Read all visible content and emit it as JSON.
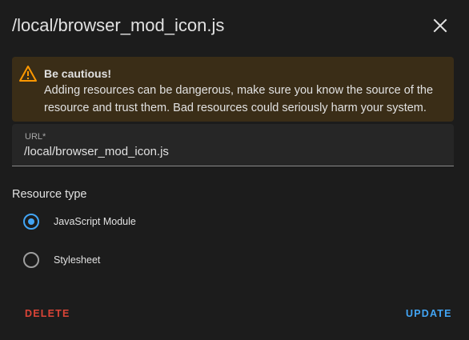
{
  "dialog": {
    "title": "/local/browser_mod_icon.js",
    "close_icon": "close-icon"
  },
  "alert": {
    "icon": "warning-icon",
    "title": "Be cautious!",
    "body": "Adding resources can be dangerous, make sure you know the source of the resource and trust them. Bad resources could seriously harm your system.",
    "background_color": "#3a2d17",
    "icon_color": "#ff9800"
  },
  "url_field": {
    "label": "URL*",
    "value": "/local/browser_mod_icon.js"
  },
  "resource_type": {
    "label": "Resource type",
    "options": [
      {
        "label": "JavaScript Module",
        "checked": true
      },
      {
        "label": "Stylesheet",
        "checked": false
      }
    ]
  },
  "actions": {
    "delete_label": "DELETE",
    "update_label": "UPDATE",
    "delete_color": "#db4437",
    "update_color": "#42a5f5"
  }
}
